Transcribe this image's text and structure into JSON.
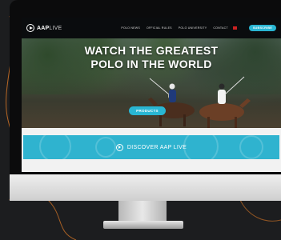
{
  "brand": {
    "name_bold": "AAP",
    "name_light": "LIVE"
  },
  "nav": {
    "items": [
      "Polo News",
      "Official Rules",
      "Polo University",
      "Contact"
    ],
    "signup_label": "SUBSCRIBE"
  },
  "hero": {
    "title_line1": "WATCH THE GREATEST",
    "title_line2": "POLO IN THE WORLD",
    "cta_label": "PRODUCTS"
  },
  "banner": {
    "label": "DISCOVER AAP LIVE"
  },
  "colors": {
    "accent": "#2fb3cf",
    "background": "#1c1d1f",
    "bezel": "#0b0b0c",
    "chin": "#e6e6e6"
  },
  "icons": [
    "play-circle-icon",
    "logo-mark-icon"
  ]
}
